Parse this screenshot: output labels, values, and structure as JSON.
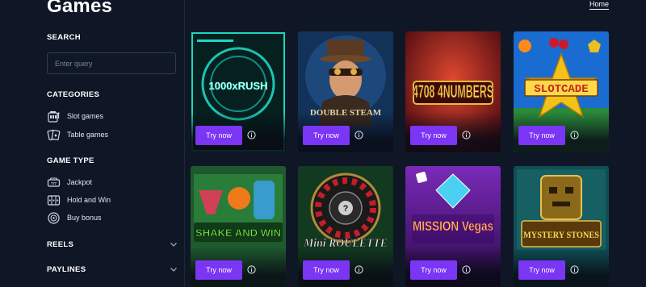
{
  "page": {
    "title": "Games",
    "home_link": "Home"
  },
  "sidebar": {
    "search": {
      "heading": "SEARCH",
      "placeholder": "Enter query",
      "value": ""
    },
    "categories": {
      "heading": "CATEGORIES",
      "items": [
        {
          "label": "Slot games",
          "icon": "slot-machine-icon"
        },
        {
          "label": "Table games",
          "icon": "playing-cards-icon"
        }
      ]
    },
    "game_type": {
      "heading": "GAME TYPE",
      "items": [
        {
          "label": "Jackpot",
          "icon": "jackpot-icon"
        },
        {
          "label": "Hold and Win",
          "icon": "reels-icon"
        },
        {
          "label": "Buy bonus",
          "icon": "coin-icon"
        }
      ]
    },
    "reels": {
      "label": "REELS",
      "icon": "chevron-down-icon"
    },
    "paylines": {
      "label": "PAYLINES",
      "icon": "chevron-down-icon"
    }
  },
  "games": [
    {
      "title_art": "1000xRUSH",
      "button": "Try now",
      "theme": "#0b6f6a"
    },
    {
      "title_art": "DOUBLE STEAM",
      "button": "Try now",
      "theme": "#1d3d66"
    },
    {
      "title_art": "4708 4NUMBERS",
      "button": "Try now",
      "theme": "#7a0f1a"
    },
    {
      "title_art": "SLOTCADE",
      "button": "Try now",
      "theme": "#1e6fd1"
    },
    {
      "title_art": "SHAKE AND WIN",
      "button": "Try now",
      "theme": "#2f7a3c"
    },
    {
      "title_art": "Mini ROULETTE",
      "button": "Try now",
      "theme": "#1f4a2c"
    },
    {
      "title_art": "MISSION Vegas",
      "button": "Try now",
      "theme": "#4a1f7a"
    },
    {
      "title_art": "MYSTERY STONES",
      "button": "Try now",
      "theme": "#0f5a60"
    }
  ],
  "colors": {
    "background": "#0f1726",
    "accent": "#7a35f5",
    "border": "#2f3b50"
  }
}
